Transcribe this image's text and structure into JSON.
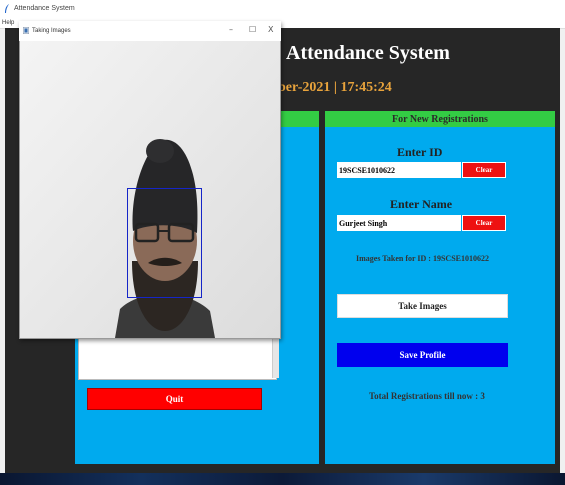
{
  "window": {
    "title": "Attendance System",
    "menu": [
      "Help"
    ]
  },
  "app": {
    "title": "Attendance System",
    "date_partial": "ber-2021",
    "separator": "|",
    "time": "17:45:24",
    "datetime_text": "ber-2021  |  17:45:24"
  },
  "left_panel": {
    "header": "",
    "quit_label": "Quit"
  },
  "right_panel": {
    "header": "For New Registrations",
    "enter_id_label": "Enter ID",
    "id_value": "19SCSE1010622",
    "clear_label": "Clear",
    "enter_name_label": "Enter Name",
    "name_value": "Gurjeet Singh",
    "images_taken_text": "Images Taken for ID : 19SCSE1010622",
    "take_images_label": "Take Images",
    "save_profile_label": "Save Profile",
    "total_registrations_text": "Total Registrations till now  : 3"
  },
  "popup": {
    "title": "Taking Images",
    "minimize": "–",
    "maximize": "☐",
    "close": "X"
  },
  "colors": {
    "panel_bg": "#00aaee",
    "header_green": "#33cc44",
    "quit_red": "#ff0000",
    "clear_red": "#ee1111",
    "save_blue": "#0000ee",
    "date_orange": "#e8a33c",
    "face_box": "#1525c8"
  }
}
